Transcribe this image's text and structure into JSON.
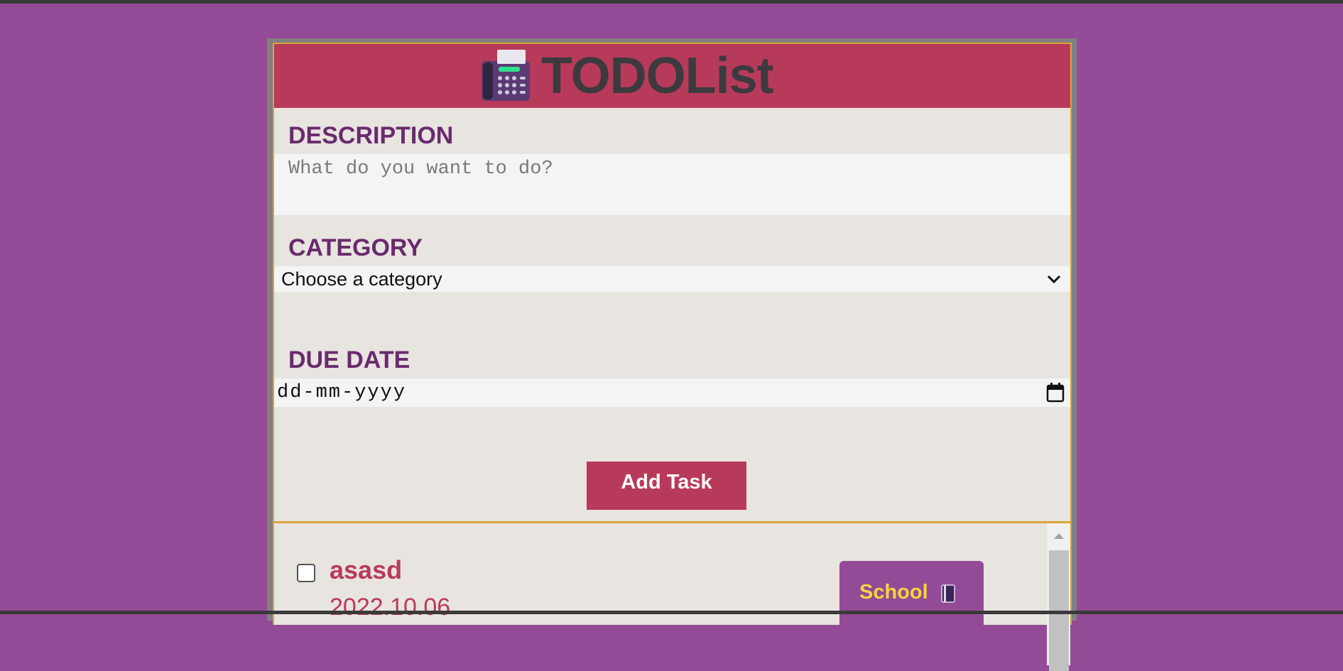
{
  "app": {
    "title": "TODOList",
    "logo_icon": "fax-machine-icon"
  },
  "form": {
    "description": {
      "label": "DESCRIPTION",
      "placeholder": "What do you want to do?"
    },
    "category": {
      "label": "CATEGORY",
      "selected": "Choose a category"
    },
    "due_date": {
      "label": "DUE DATE",
      "value": "dd-mm-yyyy"
    },
    "add_button": "Add Task"
  },
  "tasks": [
    {
      "checked": false,
      "title": "asasd",
      "date": "2022.10.06",
      "category": "School",
      "category_icon": "notebook-icon"
    }
  ],
  "colors": {
    "page_bg": "#944b97",
    "header_bg": "#b83a5a",
    "label": "#6a2a6e",
    "badge_text": "#f5d442"
  }
}
